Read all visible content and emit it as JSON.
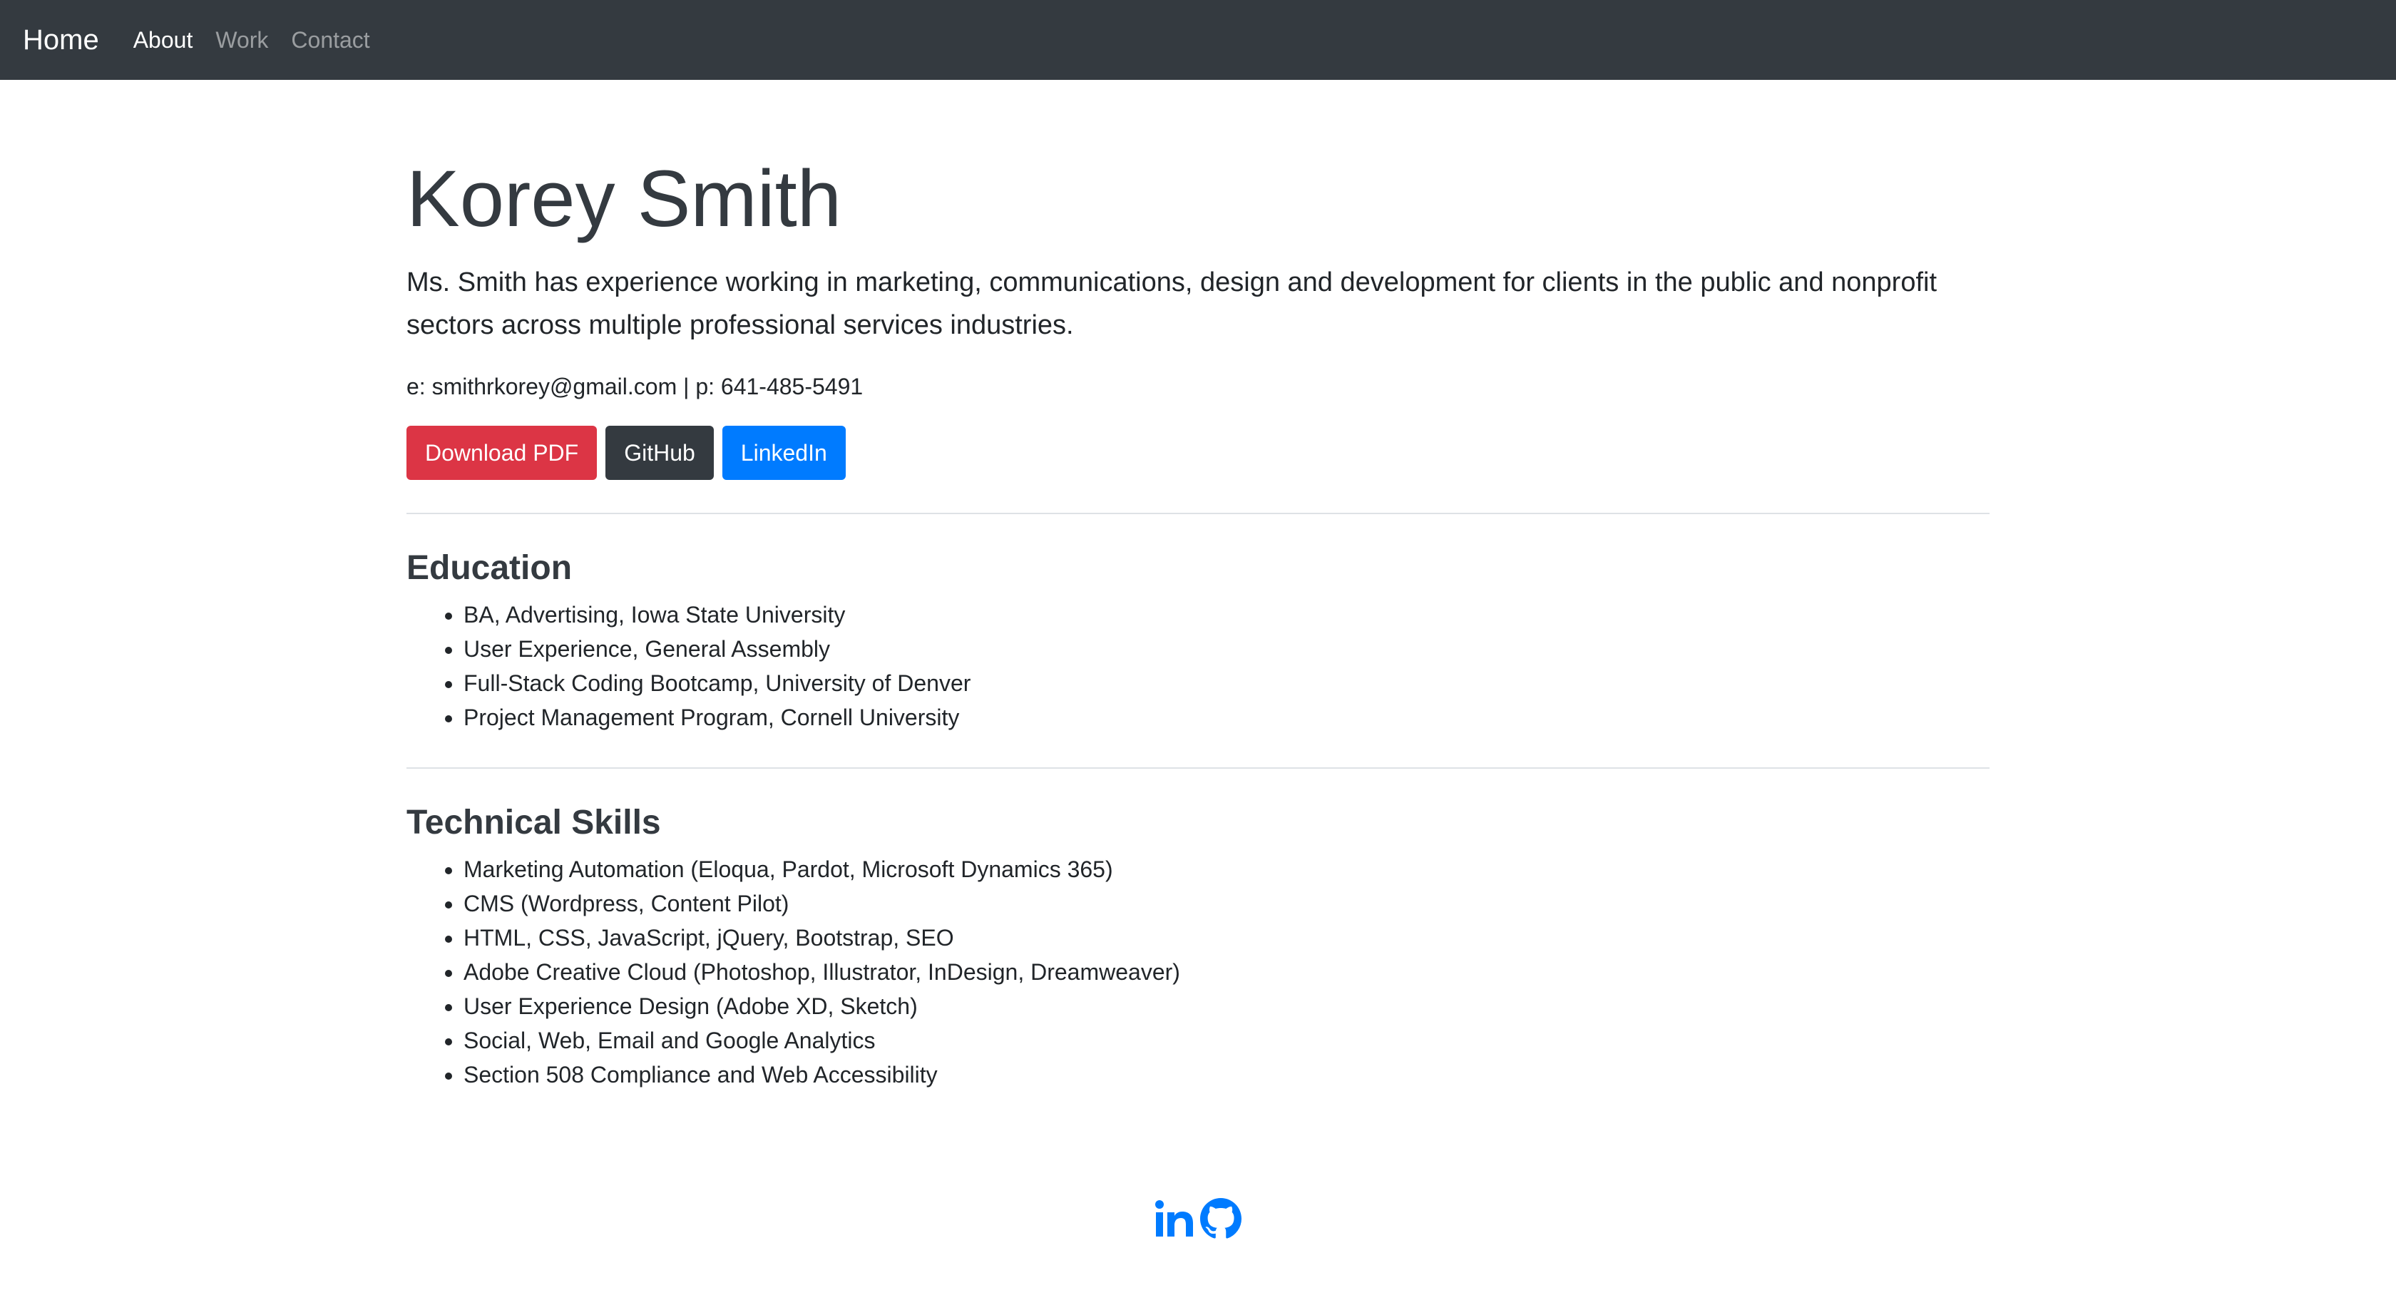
{
  "nav": {
    "brand": "Home",
    "links": [
      "About",
      "Work",
      "Contact"
    ]
  },
  "profile": {
    "name": "Korey Smith",
    "summary": "Ms. Smith has experience working in marketing, communications, design and development for clients in the public and nonprofit sectors across multiple professional services industries.",
    "contact": "e: smithrkorey@gmail.com | p: 641-485-5491"
  },
  "buttons": {
    "download": "Download PDF",
    "github": "GitHub",
    "linkedin": "LinkedIn"
  },
  "education": {
    "title": "Education",
    "items": [
      "BA, Advertising, Iowa State University",
      "User Experience, General Assembly",
      "Full-Stack Coding Bootcamp, University of Denver",
      "Project Management Program, Cornell University"
    ]
  },
  "skills": {
    "title": "Technical Skills",
    "items": [
      "Marketing Automation (Eloqua, Pardot, Microsoft Dynamics 365)",
      "CMS (Wordpress, Content Pilot)",
      "HTML, CSS, JavaScript, jQuery, Bootstrap, SEO",
      "Adobe Creative Cloud (Photoshop, Illustrator, InDesign, Dreamweaver)",
      "User Experience Design (Adobe XD, Sketch)",
      "Social, Web, Email and Google Analytics",
      "Section 508 Compliance and Web Accessibility"
    ]
  },
  "footer": {
    "icons": [
      "linkedin-icon",
      "github-icon"
    ]
  },
  "colors": {
    "navbar": "#343a40",
    "danger": "#dc3545",
    "dark": "#343a40",
    "primary": "#007bff"
  }
}
